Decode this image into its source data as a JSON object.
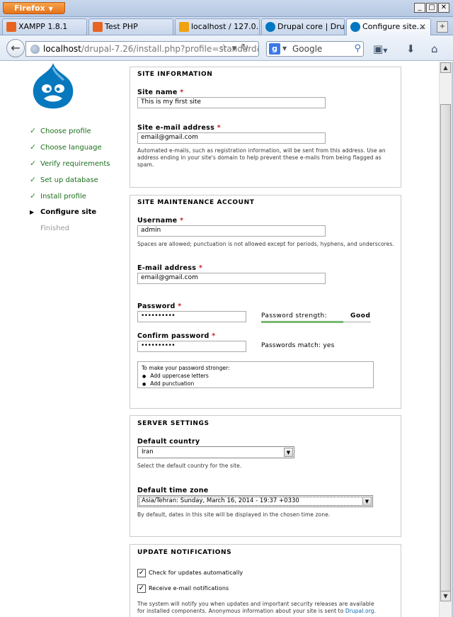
{
  "browser": {
    "app_button": "Firefox",
    "tabs": [
      {
        "label": "XAMPP 1.8.1",
        "icon": "xampp-icon",
        "color": "#e76420"
      },
      {
        "label": "Test PHP",
        "icon": "xampp-icon",
        "color": "#e76420"
      },
      {
        "label": "localhost / 127.0....",
        "icon": "phpmyadmin-icon",
        "color": "#f0a10e"
      },
      {
        "label": "Drupal core | Dru...",
        "icon": "drupal-icon",
        "color": "#0077c0"
      },
      {
        "label": "Configure site...",
        "icon": "drupal-icon",
        "color": "#0077c0",
        "active": true
      }
    ],
    "url_host": "localhost",
    "url_path": "/drupal-7.26/install.php?profile=standard&",
    "search_engine": "Google",
    "search_placeholder": "Google"
  },
  "sidebar": {
    "tasks": [
      {
        "label": "Choose profile",
        "state": "done"
      },
      {
        "label": "Choose language",
        "state": "done"
      },
      {
        "label": "Verify requirements",
        "state": "done"
      },
      {
        "label": "Set up database",
        "state": "done"
      },
      {
        "label": "Install profile",
        "state": "done"
      },
      {
        "label": "Configure site",
        "state": "active"
      },
      {
        "label": "Finished",
        "state": "pending"
      }
    ]
  },
  "site_info": {
    "legend": "SITE INFORMATION",
    "site_name_label": "Site name",
    "site_name_value": "This is my first site",
    "email_label": "Site e-mail address",
    "email_value": "email@gmail.com",
    "email_desc": "Automated e-mails, such as registration information, will be sent from this address. Use an address ending in your site's domain to help prevent these e-mails from being flagged as spam."
  },
  "maintenance": {
    "legend": "SITE MAINTENANCE ACCOUNT",
    "username_label": "Username",
    "username_value": "admin",
    "username_desc": "Spaces are allowed; punctuation is not allowed except for periods, hyphens, and underscores.",
    "email_label": "E-mail address",
    "email_value": "email@gmail.com",
    "password_label": "Password",
    "password_value": "••••••••••",
    "strength_label": "Password strength:",
    "strength_value": "Good",
    "strength_fraction": 0.75,
    "confirm_label": "Confirm password",
    "confirm_value": "••••••••••",
    "match_text": "Passwords match: yes",
    "suggest_title": "To make your password stronger:",
    "suggestions": [
      "Add uppercase letters",
      "Add punctuation"
    ]
  },
  "server": {
    "legend": "SERVER SETTINGS",
    "country_label": "Default country",
    "country_value": "Iran",
    "country_desc": "Select the default country for the site.",
    "timezone_label": "Default time zone",
    "timezone_value": "Asia/Tehran: Sunday, March 16, 2014 - 19:37 +0330",
    "timezone_desc": "By default, dates in this site will be displayed in the chosen time zone."
  },
  "updates": {
    "legend": "UPDATE NOTIFICATIONS",
    "check_updates_label": "Check for updates automatically",
    "check_updates": true,
    "email_notify_label": "Receive e-mail notifications",
    "email_notify": true,
    "desc": "The system will notify you when updates and important security releases are available for installed components. Anonymous information about your site is sent to ",
    "desc_link": "Drupal.org",
    "desc_end": "."
  },
  "required_mark": "*"
}
